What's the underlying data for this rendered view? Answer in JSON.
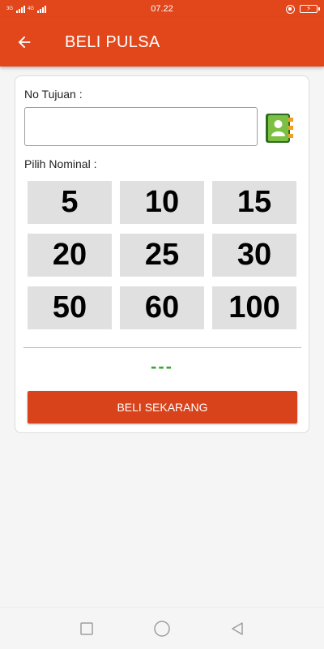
{
  "status_bar": {
    "net_left": "3G",
    "net_right": "4G",
    "time": "07.22"
  },
  "app_bar": {
    "title": "BELI PULSA",
    "back_icon": "arrow-left-icon"
  },
  "form": {
    "destination_label": "No Tujuan :",
    "destination_value": "",
    "contact_icon": "contact-book-icon",
    "nominal_label": "Pilih Nominal :",
    "nominal_options": [
      "5",
      "10",
      "15",
      "20",
      "25",
      "30",
      "50",
      "60",
      "100"
    ],
    "result_text": "---",
    "buy_button_label": "BELI SEKARANG"
  },
  "colors": {
    "primary": "#e2471c",
    "button": "#d8431b",
    "nominal_bg": "#e0e0e0",
    "result": "#3aa53a"
  },
  "nav": {
    "recent_icon": "square-recents-icon",
    "home_icon": "circle-home-icon",
    "back_icon": "triangle-back-icon"
  }
}
